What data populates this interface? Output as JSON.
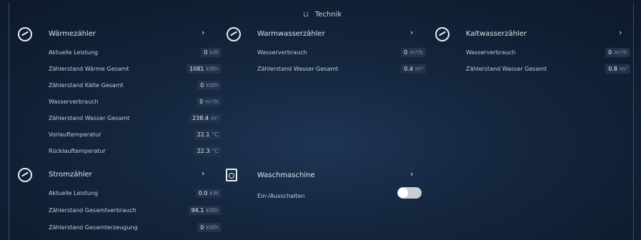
{
  "header": {
    "title": "Technik",
    "icon": "building-icon"
  },
  "waermezaehler": {
    "title": "Wärmezähler",
    "rows": [
      {
        "label": "Aktuelle Leistung",
        "value": "0",
        "unit": "kW"
      },
      {
        "label": "Zählerstand Wärme Gesamt",
        "value": "1081",
        "unit": "kWh"
      },
      {
        "label": "Zählerstand Kälte Gesamt",
        "value": "0",
        "unit": "kWh"
      },
      {
        "label": "Wasserverbrauch",
        "value": "0",
        "unit": "m³/h"
      },
      {
        "label": "Zählerstand Wasser Gesamt",
        "value": "238.4",
        "unit": "m³"
      },
      {
        "label": "Vorlauftemperatur",
        "value": "22.1",
        "unit": "°C"
      },
      {
        "label": "Rücklauftemperatur",
        "value": "22.3",
        "unit": "°C"
      }
    ]
  },
  "warmwasserzaehler": {
    "title": "Warmwasserzähler",
    "rows": [
      {
        "label": "Wasserverbrauch",
        "value": "0",
        "unit": "m³/h"
      },
      {
        "label": "Zählerstand Wasser Gesamt",
        "value": "0.4",
        "unit": "m³"
      }
    ]
  },
  "kaltwasserzaehler": {
    "title": "Kaltwasserzähler",
    "rows": [
      {
        "label": "Wasserverbrauch",
        "value": "0",
        "unit": "m³/h"
      },
      {
        "label": "Zählerstand Wasser Gesamt",
        "value": "0.8",
        "unit": "m³"
      }
    ]
  },
  "stromzaehler": {
    "title": "Stromzähler",
    "rows": [
      {
        "label": "Aktuelle Leistung",
        "value": "0.0",
        "unit": "kW"
      },
      {
        "label": "Zählerstand Gesamtverbrauch",
        "value": "94.1",
        "unit": "kWh"
      },
      {
        "label": "Zählerstand Gesamterzeugung",
        "value": "0",
        "unit": "kWh"
      }
    ]
  },
  "waschmaschine": {
    "title": "Waschmaschine",
    "switch_label": "Ein-/Ausschalten",
    "switch_on": true
  },
  "chevron": "›"
}
